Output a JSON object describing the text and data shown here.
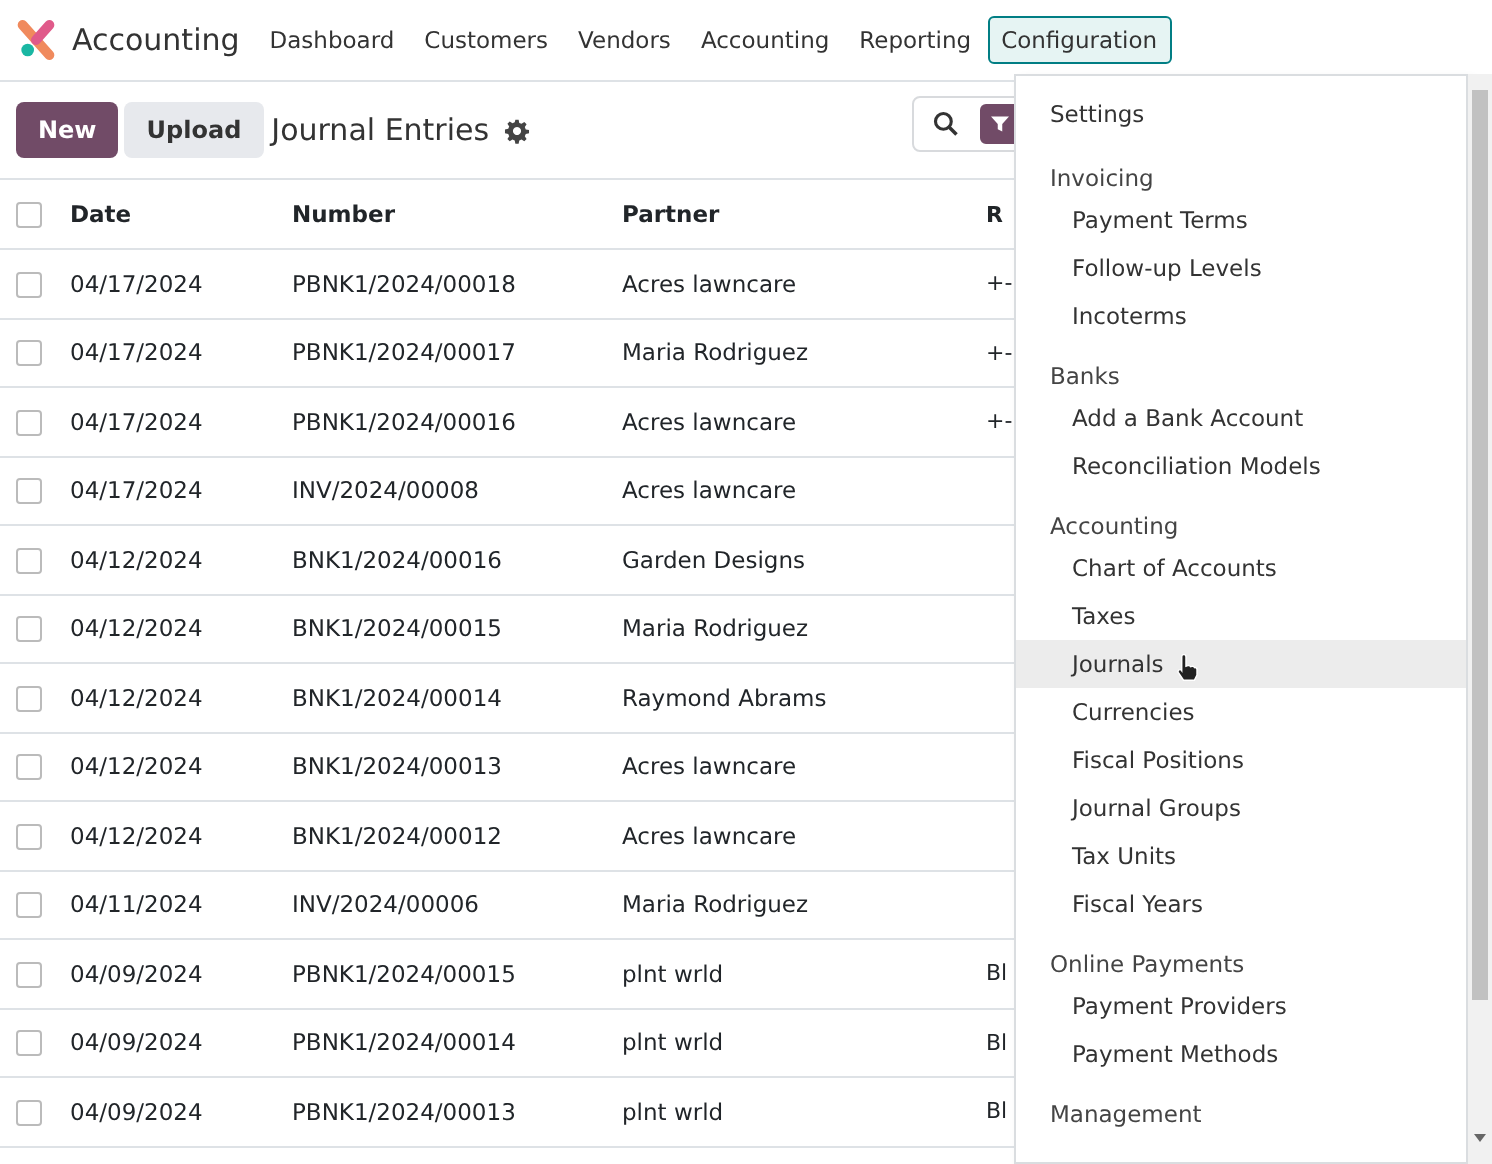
{
  "navbar": {
    "app_name": "Accounting",
    "items": [
      {
        "label": "Dashboard",
        "selected": false
      },
      {
        "label": "Customers",
        "selected": false
      },
      {
        "label": "Vendors",
        "selected": false
      },
      {
        "label": "Accounting",
        "selected": false
      },
      {
        "label": "Reporting",
        "selected": false
      },
      {
        "label": "Configuration",
        "selected": true
      }
    ]
  },
  "control_panel": {
    "buttons": [
      {
        "label": "New",
        "kind": "primary"
      },
      {
        "label": "Upload",
        "kind": "secondary"
      }
    ],
    "title": "Journal Entries"
  },
  "table": {
    "select_all_checked": false,
    "columns": [
      "Date",
      "Number",
      "Partner",
      "R"
    ],
    "rows": [
      {
        "checked": false,
        "cells": [
          "04/17/2024",
          "PBNK1/2024/00018",
          "Acres lawncare",
          "+-"
        ]
      },
      {
        "checked": false,
        "cells": [
          "04/17/2024",
          "PBNK1/2024/00017",
          "Maria Rodriguez",
          "+-"
        ]
      },
      {
        "checked": false,
        "cells": [
          "04/17/2024",
          "PBNK1/2024/00016",
          "Acres lawncare",
          "+-"
        ]
      },
      {
        "checked": false,
        "cells": [
          "04/17/2024",
          "INV/2024/00008",
          "Acres lawncare"
        ]
      },
      {
        "checked": false,
        "cells": [
          "04/12/2024",
          "BNK1/2024/00016",
          "Garden Designs"
        ]
      },
      {
        "checked": false,
        "cells": [
          "04/12/2024",
          "BNK1/2024/00015",
          "Maria Rodriguez"
        ]
      },
      {
        "checked": false,
        "cells": [
          "04/12/2024",
          "BNK1/2024/00014",
          "Raymond Abrams"
        ]
      },
      {
        "checked": false,
        "cells": [
          "04/12/2024",
          "BNK1/2024/00013",
          "Acres lawncare"
        ]
      },
      {
        "checked": false,
        "cells": [
          "04/12/2024",
          "BNK1/2024/00012",
          "Acres lawncare"
        ]
      },
      {
        "checked": false,
        "cells": [
          "04/11/2024",
          "INV/2024/00006",
          "Maria Rodriguez"
        ]
      },
      {
        "checked": false,
        "cells": [
          "04/09/2024",
          "PBNK1/2024/00015",
          "plnt wrld",
          "Bl"
        ]
      },
      {
        "checked": false,
        "cells": [
          "04/09/2024",
          "PBNK1/2024/00014",
          "plnt wrld",
          "Bl"
        ]
      },
      {
        "checked": false,
        "cells": [
          "04/09/2024",
          "PBNK1/2024/00013",
          "plnt wrld",
          "Bl"
        ]
      }
    ]
  },
  "dropdown": {
    "entries": [
      {
        "kind": "top",
        "label": "Settings",
        "selected": false
      },
      {
        "kind": "heading",
        "label": "Invoicing"
      },
      {
        "kind": "item",
        "label": "Payment Terms",
        "selected": false
      },
      {
        "kind": "item",
        "label": "Follow-up Levels",
        "selected": false
      },
      {
        "kind": "item",
        "label": "Incoterms",
        "selected": false
      },
      {
        "kind": "heading",
        "label": "Banks"
      },
      {
        "kind": "item",
        "label": "Add a Bank Account",
        "selected": false
      },
      {
        "kind": "item",
        "label": "Reconciliation Models",
        "selected": false
      },
      {
        "kind": "heading",
        "label": "Accounting"
      },
      {
        "kind": "item",
        "label": "Chart of Accounts",
        "selected": false
      },
      {
        "kind": "item",
        "label": "Taxes",
        "selected": false
      },
      {
        "kind": "item",
        "label": "Journals",
        "selected": true
      },
      {
        "kind": "item",
        "label": "Currencies",
        "selected": false
      },
      {
        "kind": "item",
        "label": "Fiscal Positions",
        "selected": false
      },
      {
        "kind": "item",
        "label": "Journal Groups",
        "selected": false
      },
      {
        "kind": "item",
        "label": "Tax Units",
        "selected": false
      },
      {
        "kind": "item",
        "label": "Fiscal Years",
        "selected": false
      },
      {
        "kind": "heading",
        "label": "Online Payments"
      },
      {
        "kind": "item",
        "label": "Payment Providers",
        "selected": false
      },
      {
        "kind": "item",
        "label": "Payment Methods",
        "selected": false
      },
      {
        "kind": "heading",
        "label": "Management"
      }
    ]
  }
}
